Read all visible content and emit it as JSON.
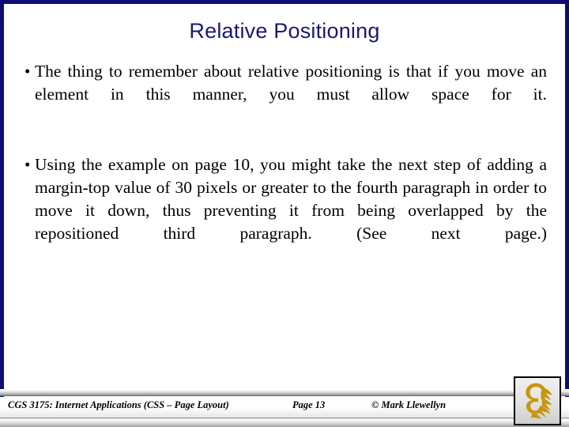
{
  "slide": {
    "title": "Relative Positioning",
    "title_color": "#191970",
    "frame_color": "#0d0d75",
    "background_color": "#ffffff",
    "bullets": [
      {
        "marker": "•",
        "text": "The thing to remember about relative positioning is that if you move an element in this manner, you must allow space for it."
      },
      {
        "marker": "•",
        "text": "Using the example on page 10, you might take the next step of adding a margin-top value of 30 pixels or greater to the fourth paragraph in order to move it down, thus preventing it from being overlapped by the repositioned third paragraph.   (See next page.)"
      }
    ]
  },
  "footer": {
    "course": "CGS 3175: Internet Applications (CSS – Page Layout)",
    "page": "Page 13",
    "copyright": "© Mark Llewellyn",
    "logo_name": "ucf-pegasus-logo",
    "logo_color": "#C8960C"
  }
}
